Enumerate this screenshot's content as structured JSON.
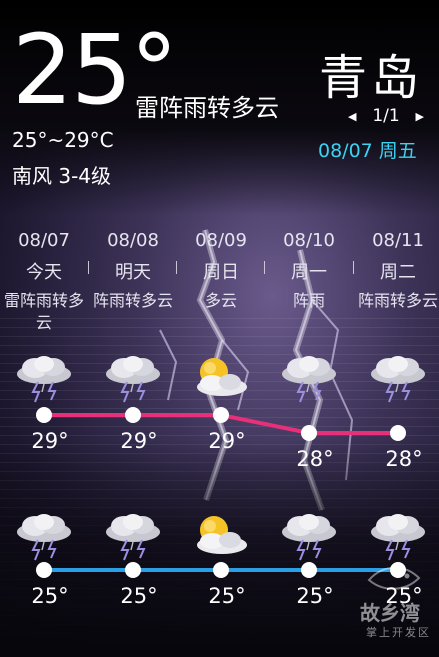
{
  "current": {
    "temperature": "25°",
    "condition": "雷阵雨转多云",
    "range": "25°~29°C",
    "wind": "南风 3-4级"
  },
  "location": {
    "city": "青岛",
    "pager": "1/1",
    "date": "08/07 周五"
  },
  "forecast": [
    {
      "date": "08/07",
      "day": "今天",
      "condition": "雷阵雨转多云",
      "icon": "thunderstorm-icon",
      "high": "29°",
      "low": "25°",
      "high_value": 29,
      "low_value": 25
    },
    {
      "date": "08/08",
      "day": "明天",
      "condition": "阵雨转多云",
      "icon": "thunderstorm-icon",
      "high": "29°",
      "low": "25°",
      "high_value": 29,
      "low_value": 25
    },
    {
      "date": "08/09",
      "day": "周日",
      "condition": "多云",
      "icon": "partly-cloudy-icon",
      "high": "29°",
      "low": "25°",
      "high_value": 29,
      "low_value": 25
    },
    {
      "date": "08/10",
      "day": "周一",
      "condition": "阵雨",
      "icon": "thunderstorm-icon",
      "high": "28°",
      "low": "25°",
      "high_value": 28,
      "low_value": 25
    },
    {
      "date": "08/11",
      "day": "周二",
      "condition": "阵雨转多云",
      "icon": "thunderstorm-icon",
      "high": "28°",
      "low": "25°",
      "high_value": 28,
      "low_value": 25
    }
  ],
  "watermark": {
    "title": "故乡湾",
    "subtitle": "掌上开发区"
  },
  "colors": {
    "high_line": "#e8307a",
    "low_line": "#2b9fe6",
    "date_accent": "#3cd2f2"
  }
}
